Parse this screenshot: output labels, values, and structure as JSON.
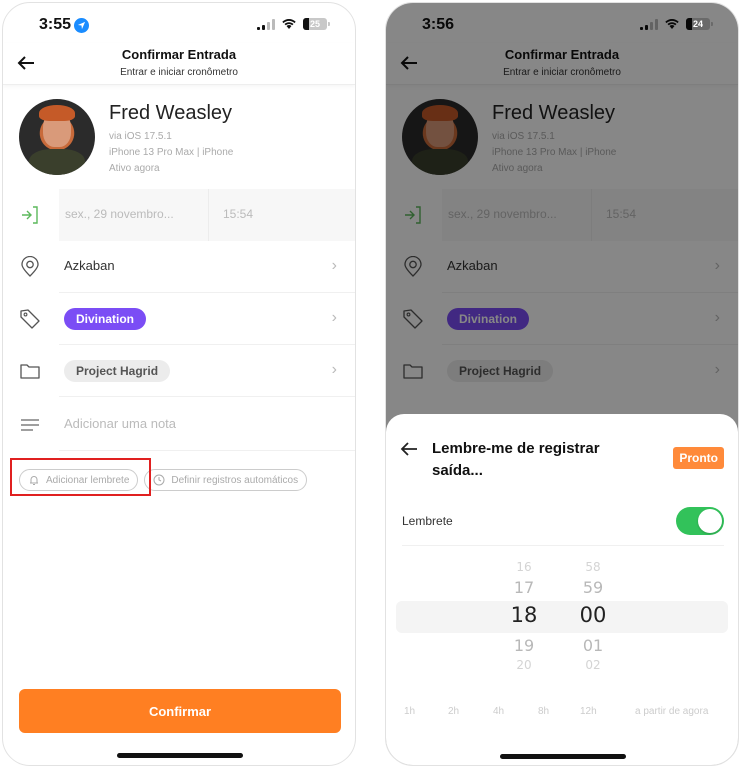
{
  "left_screen": {
    "status": {
      "time": "3:55",
      "battery": "25",
      "location_icon": "location-arrow-icon"
    },
    "nav": {
      "title": "Confirmar Entrada",
      "subtitle": "Entrar e iniciar cronômetro",
      "back_icon": "arrow-left-icon"
    },
    "profile": {
      "name": "Fred Weasley",
      "os": "via iOS 17.5.1",
      "device": "iPhone 13 Pro Max | iPhone",
      "activity": "Ativo agora"
    },
    "entry": {
      "date": "sex., 29 novembro...",
      "time": "15:54"
    },
    "location": "Azkaban",
    "tag": {
      "label": "Divination",
      "color": "#7b4df5"
    },
    "project": "Project Hagrid",
    "note_placeholder": "Adicionar uma nota",
    "pills": {
      "reminder": "Adicionar lembrete",
      "auto": "Definir registros automáticos"
    },
    "confirm_label": "Confirmar",
    "accent_color": "#ff7f22"
  },
  "right_screen": {
    "status": {
      "time": "3:56",
      "battery": "24"
    },
    "nav": {
      "title": "Confirmar Entrada",
      "subtitle": "Entrar e iniciar cronômetro"
    },
    "profile": {
      "name": "Fred Weasley",
      "os": "via iOS 17.5.1",
      "device": "iPhone 13 Pro Max | iPhone",
      "activity": "Ativo agora"
    },
    "entry": {
      "date": "sex., 29 novembro...",
      "time": "15:54"
    },
    "location": "Azkaban",
    "tag": {
      "label": "Divination"
    },
    "project": "Project Hagrid",
    "sheet": {
      "title": "Lembre-me de registrar saída...",
      "done_label": "Pronto",
      "reminder_label": "Lembrete",
      "reminder_enabled": true,
      "hours": [
        "16",
        "17",
        "18",
        "19",
        "20"
      ],
      "minutes": [
        "58",
        "59",
        "00",
        "01",
        "02"
      ],
      "selected_hour": "18",
      "selected_minute": "00",
      "quick_options": [
        "1h",
        "2h",
        "4h",
        "8h",
        "12h",
        "a partir de agora"
      ]
    }
  }
}
